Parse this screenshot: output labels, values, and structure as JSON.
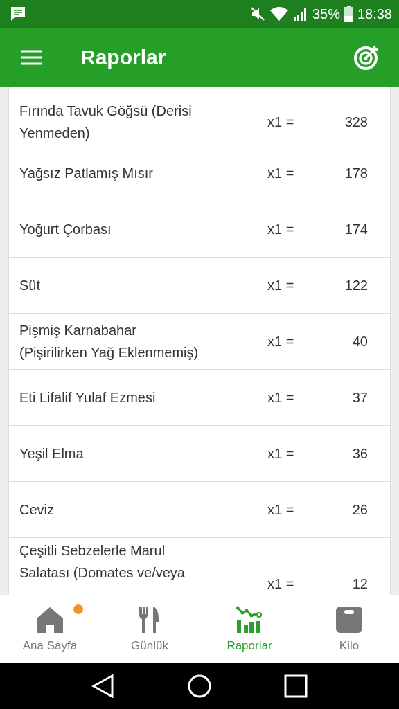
{
  "status_bar": {
    "battery": "35%",
    "time": "18:38"
  },
  "app_bar": {
    "title": "Raporlar"
  },
  "foods": [
    {
      "name": "Fırında Tavuk Göğsü (Derisi Yenmeden)",
      "quantity": "x1 =",
      "calories": "328"
    },
    {
      "name": "Yağsız Patlamış Mısır",
      "quantity": "x1 =",
      "calories": "178"
    },
    {
      "name": "Yoğurt Çorbası",
      "quantity": "x1 =",
      "calories": "174"
    },
    {
      "name": "Süt",
      "quantity": "x1 =",
      "calories": "122"
    },
    {
      "name": "Pişmiş Karnabahar (Pişirilirken Yağ Eklenmemiş)",
      "quantity": "x1 =",
      "calories": "40"
    },
    {
      "name": "Eti Lifalif Yulaf Ezmesi",
      "quantity": "x1 =",
      "calories": "37"
    },
    {
      "name": "Yeşil Elma",
      "quantity": "x1 =",
      "calories": "36"
    },
    {
      "name": "Ceviz",
      "quantity": "x1 =",
      "calories": "26"
    },
    {
      "name": "Çeşitli Sebzelerle Marul Salatası (Domates ve/veya",
      "quantity": "x1 =",
      "calories": "12"
    }
  ],
  "bottom_nav": [
    {
      "kind": "home",
      "label": "Ana Sayfa",
      "selected": false,
      "badge": true
    },
    {
      "kind": "diary",
      "label": "Günlük",
      "selected": false,
      "badge": false
    },
    {
      "kind": "reports",
      "label": "Raporlar",
      "selected": true,
      "badge": false
    },
    {
      "kind": "weight",
      "label": "Kilo",
      "selected": false,
      "badge": false
    }
  ]
}
